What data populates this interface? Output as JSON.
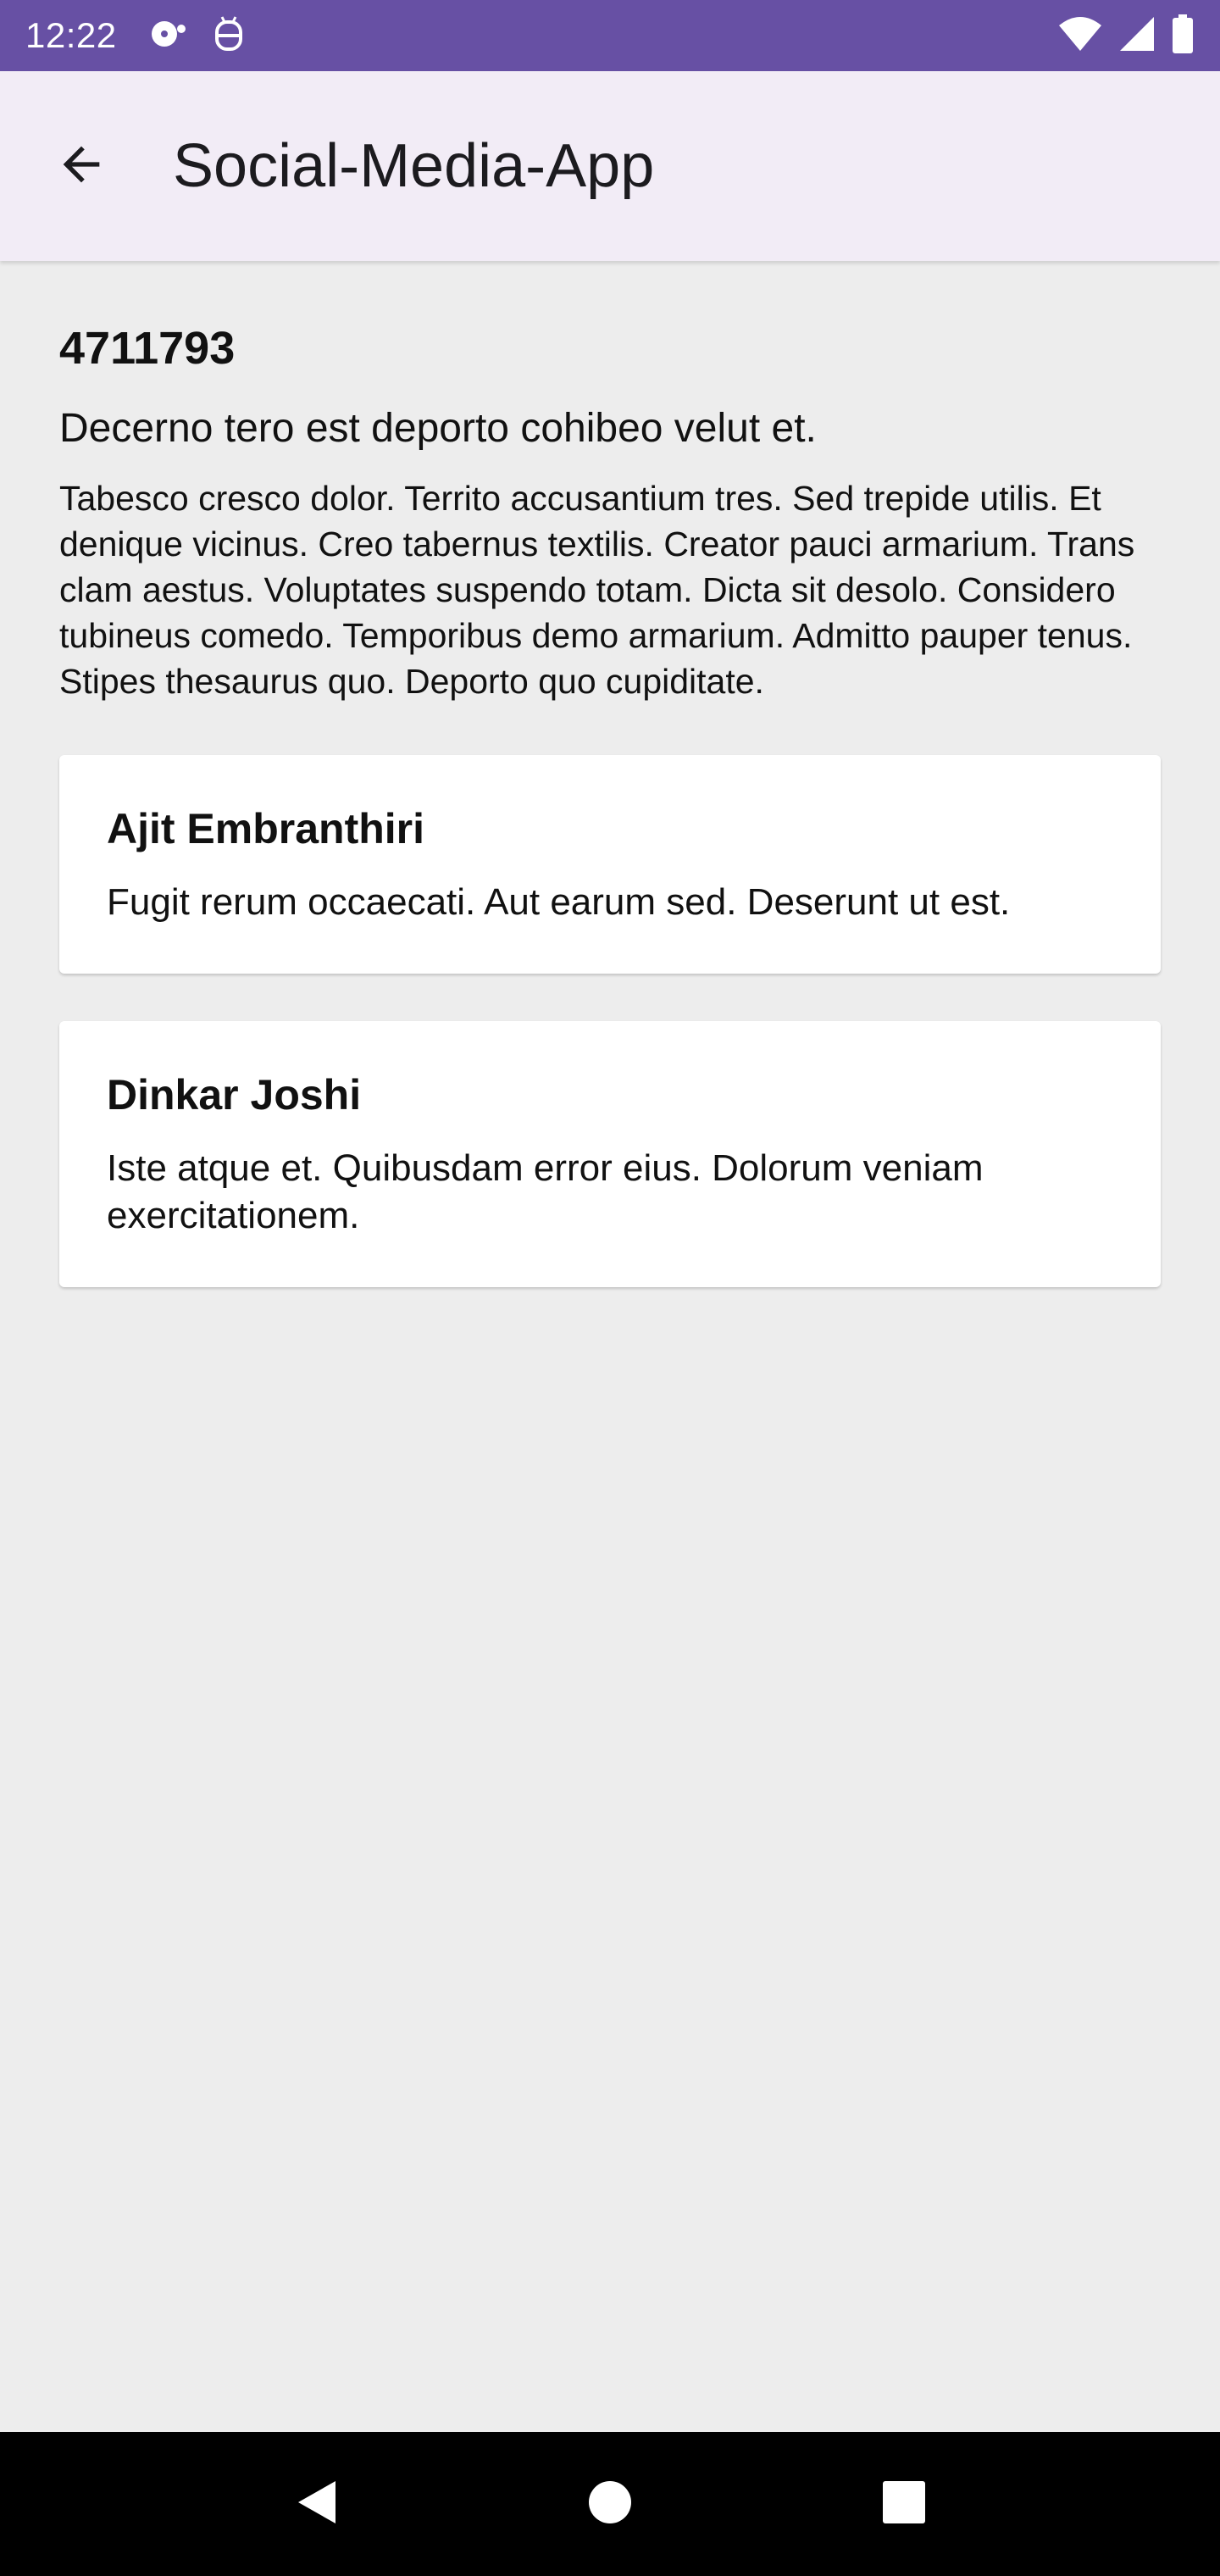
{
  "status_bar": {
    "time": "12:22",
    "icons": [
      "media-icon",
      "android-debug-icon",
      "wifi-icon",
      "signal-icon",
      "battery-icon"
    ]
  },
  "app_bar": {
    "title": "Social-Media-App",
    "back_icon": "arrow-back-icon"
  },
  "post": {
    "id": "4711793",
    "title": "Decerno tero est deporto cohibeo velut et.",
    "body": "Tabesco cresco dolor. Territo accusantium tres. Sed trepide utilis. Et denique vicinus. Creo tabernus textilis. Creator pauci armarium. Trans clam aestus. Voluptates suspendo totam. Dicta sit desolo. Considero tubineus comedo. Temporibus demo armarium. Admitto pauper tenus. Stipes thesaurus quo. Deporto quo cupiditate."
  },
  "comments": [
    {
      "author": "Ajit Embranthiri",
      "text": "Fugit rerum occaecati. Aut earum sed. Deserunt ut est."
    },
    {
      "author": "Dinkar Joshi",
      "text": "Iste atque et. Quibusdam error eius. Dolorum veniam exercitationem."
    }
  ],
  "nav_bar": {
    "buttons": [
      "back-triangle-icon",
      "home-circle-icon",
      "recents-square-icon"
    ]
  },
  "colors": {
    "status_bar": "#6750a4",
    "app_bar": "#f2ecf6",
    "background": "#ededed",
    "card": "#ffffff",
    "nav_bar": "#000000"
  }
}
